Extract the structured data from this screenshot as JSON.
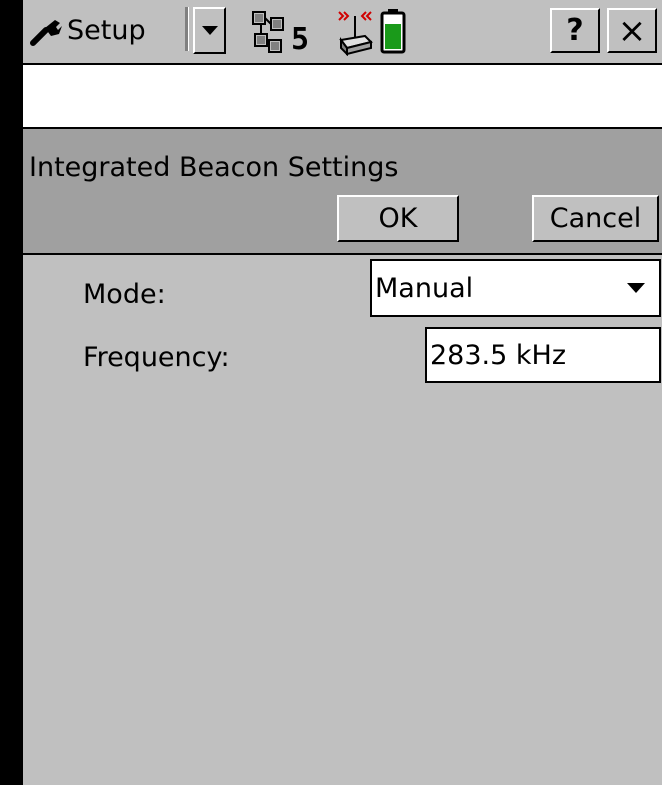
{
  "topbar": {
    "menu_label": "Setup",
    "satellite_count": "5",
    "help_label": "?",
    "close_label": "×"
  },
  "dialog": {
    "title": "Integrated Beacon Settings",
    "ok_label": "OK",
    "cancel_label": "Cancel"
  },
  "form": {
    "mode_label": "Mode:",
    "mode_value": "Manual",
    "frequency_label": "Frequency:",
    "frequency_value": "283.5 kHz"
  },
  "colors": {
    "background": "#c0c0c0",
    "header": "#a0a0a0",
    "battery_fill": "#1a9a1a"
  },
  "battery_level": 0.7
}
